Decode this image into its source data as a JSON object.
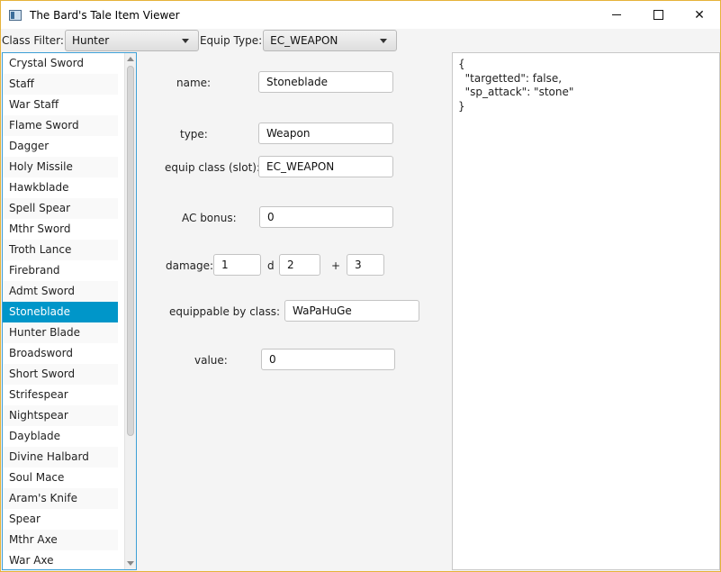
{
  "window": {
    "title": "The Bard's Tale Item Viewer",
    "minimize": "minimize",
    "maximize": "maximize",
    "close": "✕"
  },
  "toolbar": {
    "class_filter_label": "Class Filter:",
    "class_filter_value": "Hunter",
    "equip_type_label": "Equip Type:",
    "equip_type_value": "EC_WEAPON"
  },
  "items": [
    "Crystal Sword",
    "Staff",
    "War Staff",
    "Flame Sword",
    "Dagger",
    "Holy Missile",
    "Hawkblade",
    "Spell Spear",
    "Mthr Sword",
    "Troth Lance",
    "Firebrand",
    "Admt Sword",
    "Stoneblade",
    "Hunter Blade",
    "Broadsword",
    "Short Sword",
    "Strifespear",
    "Nightspear",
    "Dayblade",
    "Divine Halbard",
    "Soul Mace",
    "Aram's Knife",
    "Spear",
    "Mthr Axe",
    "War Axe"
  ],
  "selected_index": 12,
  "form": {
    "name_label": "name:",
    "name_value": "Stoneblade",
    "type_label": "type:",
    "type_value": "Weapon",
    "equip_class_label": "equip class (slot):",
    "equip_class_value": "EC_WEAPON",
    "ac_label": "AC bonus:",
    "ac_value": "0",
    "damage_label": "damage:",
    "damage_count": "1",
    "damage_d": "d",
    "damage_sides": "2",
    "damage_plus": "+",
    "damage_bonus": "3",
    "equippable_label": "equippable by class:",
    "equippable_value": "WaPaHuGe",
    "value_label": "value:",
    "value_value": "0"
  },
  "json_lines": [
    "{",
    "  \"targetted\": false,",
    "  \"sp_attack\": \"stone\"",
    "}"
  ],
  "colors": {
    "selection": "#0096c9",
    "list_border": "#3d9fd6",
    "window_border": "#e6b33a"
  }
}
